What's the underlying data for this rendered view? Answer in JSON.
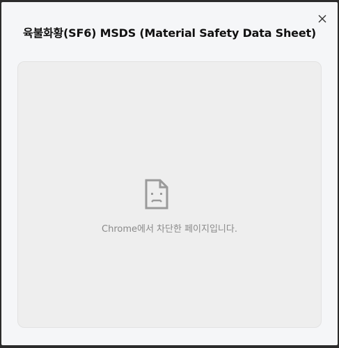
{
  "dialog": {
    "title": "육불화황(SF6) MSDS (Material Safety Data Sheet)",
    "close_label": "×"
  },
  "frame": {
    "blocked_message": "Chrome에서 차단한 페이지입니다.",
    "icon": "sad-page-icon"
  },
  "colors": {
    "backdrop": "#2b2b2b",
    "modal_bg": "#f5f6f8",
    "frame_bg": "#eeeeee",
    "icon_color": "#9a9a9a",
    "message_color": "#8a8a8a"
  }
}
